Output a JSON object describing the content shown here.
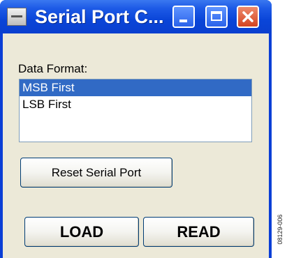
{
  "window": {
    "title": "Serial Port C...",
    "accent_color": "#0a45d8",
    "close_color": "#d44420",
    "icons": {
      "system": "window-menu-icon",
      "minimize": "minimize-icon",
      "maximize": "maximize-icon",
      "close": "close-icon"
    }
  },
  "data_format": {
    "label": "Data Format:",
    "options": [
      "MSB First",
      "LSB First"
    ],
    "selected": "MSB First",
    "selection_color": "#316ac5"
  },
  "buttons": {
    "reset": "Reset Serial Port",
    "load": "LOAD",
    "read": "READ"
  },
  "figure_code": "08129-006"
}
